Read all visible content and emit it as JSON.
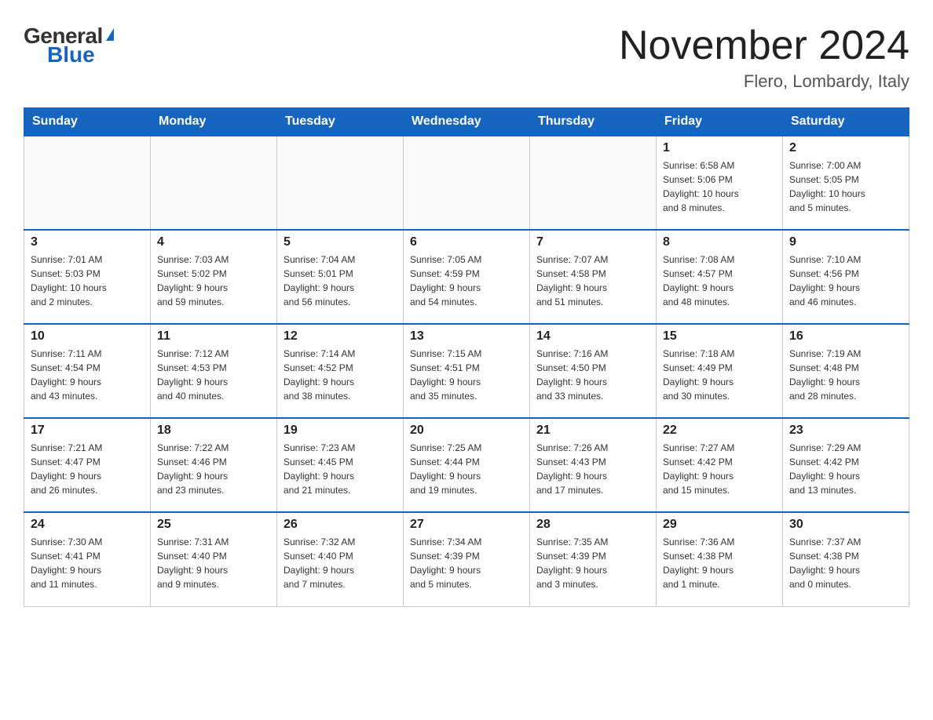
{
  "header": {
    "logo_general": "General",
    "logo_blue": "Blue",
    "title": "November 2024",
    "subtitle": "Flero, Lombardy, Italy"
  },
  "days_of_week": [
    "Sunday",
    "Monday",
    "Tuesday",
    "Wednesday",
    "Thursday",
    "Friday",
    "Saturday"
  ],
  "weeks": [
    [
      {
        "day": "",
        "info": ""
      },
      {
        "day": "",
        "info": ""
      },
      {
        "day": "",
        "info": ""
      },
      {
        "day": "",
        "info": ""
      },
      {
        "day": "",
        "info": ""
      },
      {
        "day": "1",
        "info": "Sunrise: 6:58 AM\nSunset: 5:06 PM\nDaylight: 10 hours\nand 8 minutes."
      },
      {
        "day": "2",
        "info": "Sunrise: 7:00 AM\nSunset: 5:05 PM\nDaylight: 10 hours\nand 5 minutes."
      }
    ],
    [
      {
        "day": "3",
        "info": "Sunrise: 7:01 AM\nSunset: 5:03 PM\nDaylight: 10 hours\nand 2 minutes."
      },
      {
        "day": "4",
        "info": "Sunrise: 7:03 AM\nSunset: 5:02 PM\nDaylight: 9 hours\nand 59 minutes."
      },
      {
        "day": "5",
        "info": "Sunrise: 7:04 AM\nSunset: 5:01 PM\nDaylight: 9 hours\nand 56 minutes."
      },
      {
        "day": "6",
        "info": "Sunrise: 7:05 AM\nSunset: 4:59 PM\nDaylight: 9 hours\nand 54 minutes."
      },
      {
        "day": "7",
        "info": "Sunrise: 7:07 AM\nSunset: 4:58 PM\nDaylight: 9 hours\nand 51 minutes."
      },
      {
        "day": "8",
        "info": "Sunrise: 7:08 AM\nSunset: 4:57 PM\nDaylight: 9 hours\nand 48 minutes."
      },
      {
        "day": "9",
        "info": "Sunrise: 7:10 AM\nSunset: 4:56 PM\nDaylight: 9 hours\nand 46 minutes."
      }
    ],
    [
      {
        "day": "10",
        "info": "Sunrise: 7:11 AM\nSunset: 4:54 PM\nDaylight: 9 hours\nand 43 minutes."
      },
      {
        "day": "11",
        "info": "Sunrise: 7:12 AM\nSunset: 4:53 PM\nDaylight: 9 hours\nand 40 minutes."
      },
      {
        "day": "12",
        "info": "Sunrise: 7:14 AM\nSunset: 4:52 PM\nDaylight: 9 hours\nand 38 minutes."
      },
      {
        "day": "13",
        "info": "Sunrise: 7:15 AM\nSunset: 4:51 PM\nDaylight: 9 hours\nand 35 minutes."
      },
      {
        "day": "14",
        "info": "Sunrise: 7:16 AM\nSunset: 4:50 PM\nDaylight: 9 hours\nand 33 minutes."
      },
      {
        "day": "15",
        "info": "Sunrise: 7:18 AM\nSunset: 4:49 PM\nDaylight: 9 hours\nand 30 minutes."
      },
      {
        "day": "16",
        "info": "Sunrise: 7:19 AM\nSunset: 4:48 PM\nDaylight: 9 hours\nand 28 minutes."
      }
    ],
    [
      {
        "day": "17",
        "info": "Sunrise: 7:21 AM\nSunset: 4:47 PM\nDaylight: 9 hours\nand 26 minutes."
      },
      {
        "day": "18",
        "info": "Sunrise: 7:22 AM\nSunset: 4:46 PM\nDaylight: 9 hours\nand 23 minutes."
      },
      {
        "day": "19",
        "info": "Sunrise: 7:23 AM\nSunset: 4:45 PM\nDaylight: 9 hours\nand 21 minutes."
      },
      {
        "day": "20",
        "info": "Sunrise: 7:25 AM\nSunset: 4:44 PM\nDaylight: 9 hours\nand 19 minutes."
      },
      {
        "day": "21",
        "info": "Sunrise: 7:26 AM\nSunset: 4:43 PM\nDaylight: 9 hours\nand 17 minutes."
      },
      {
        "day": "22",
        "info": "Sunrise: 7:27 AM\nSunset: 4:42 PM\nDaylight: 9 hours\nand 15 minutes."
      },
      {
        "day": "23",
        "info": "Sunrise: 7:29 AM\nSunset: 4:42 PM\nDaylight: 9 hours\nand 13 minutes."
      }
    ],
    [
      {
        "day": "24",
        "info": "Sunrise: 7:30 AM\nSunset: 4:41 PM\nDaylight: 9 hours\nand 11 minutes."
      },
      {
        "day": "25",
        "info": "Sunrise: 7:31 AM\nSunset: 4:40 PM\nDaylight: 9 hours\nand 9 minutes."
      },
      {
        "day": "26",
        "info": "Sunrise: 7:32 AM\nSunset: 4:40 PM\nDaylight: 9 hours\nand 7 minutes."
      },
      {
        "day": "27",
        "info": "Sunrise: 7:34 AM\nSunset: 4:39 PM\nDaylight: 9 hours\nand 5 minutes."
      },
      {
        "day": "28",
        "info": "Sunrise: 7:35 AM\nSunset: 4:39 PM\nDaylight: 9 hours\nand 3 minutes."
      },
      {
        "day": "29",
        "info": "Sunrise: 7:36 AM\nSunset: 4:38 PM\nDaylight: 9 hours\nand 1 minute."
      },
      {
        "day": "30",
        "info": "Sunrise: 7:37 AM\nSunset: 4:38 PM\nDaylight: 9 hours\nand 0 minutes."
      }
    ]
  ]
}
